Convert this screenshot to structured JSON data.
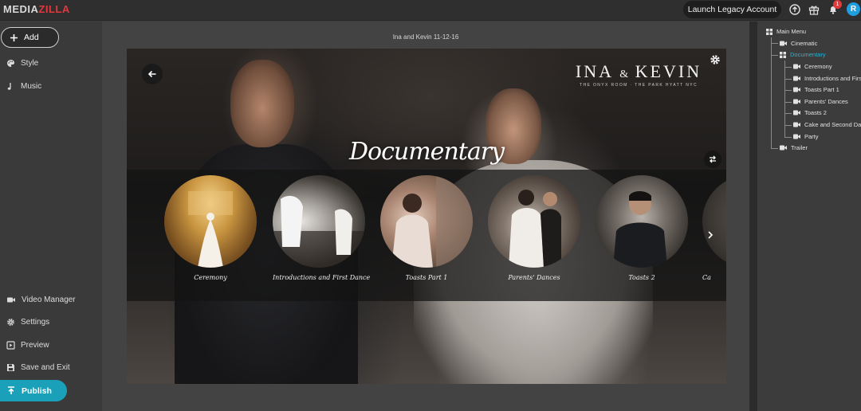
{
  "app": {
    "logo_left": "MEDIA",
    "logo_right": "ZILLA",
    "launch_label": "Launch Legacy Account",
    "notification_count": "1",
    "avatar_initial": "R",
    "accent_color": "#1aa0b8"
  },
  "sidebar": {
    "add_label": "Add",
    "top_items": [
      {
        "label": "Style",
        "icon": "palette-icon"
      },
      {
        "label": "Music",
        "icon": "music-note-icon"
      }
    ],
    "bottom_items": [
      {
        "label": "Video Manager",
        "icon": "video-camera-icon"
      },
      {
        "label": "Settings",
        "icon": "gear-icon"
      },
      {
        "label": "Preview",
        "icon": "play-square-icon"
      },
      {
        "label": "Save and Exit",
        "icon": "floppy-disk-icon"
      }
    ],
    "publish_label": "Publish"
  },
  "preview": {
    "title": "Ina and Kevin 11-12-16",
    "brand_name_left": "INA",
    "brand_amp": "&",
    "brand_name_right": "KEVIN",
    "brand_subtitle": "THE ONYX ROOM · THE PARK HYATT NYC",
    "section_title": "Documentary",
    "thumbnails": [
      {
        "label": "Ceremony"
      },
      {
        "label": "Introductions and First Dance"
      },
      {
        "label": "Toasts Part 1"
      },
      {
        "label": "Parents' Dances"
      },
      {
        "label": "Toasts 2"
      },
      {
        "label": "Ca"
      }
    ]
  },
  "tree": {
    "root": "Main Menu",
    "items": [
      {
        "label": "Cinematic",
        "level": 1,
        "icon": "video-camera-icon",
        "active": false
      },
      {
        "label": "Documentary",
        "level": 1,
        "icon": "grid-icon",
        "active": true
      },
      {
        "label": "Ceremony",
        "level": 2,
        "icon": "video-camera-icon",
        "active": false
      },
      {
        "label": "Introductions and Firs...",
        "level": 2,
        "icon": "video-camera-icon",
        "active": false
      },
      {
        "label": "Toasts Part 1",
        "level": 2,
        "icon": "video-camera-icon",
        "active": false
      },
      {
        "label": "Parents' Dances",
        "level": 2,
        "icon": "video-camera-icon",
        "active": false
      },
      {
        "label": "Toasts 2",
        "level": 2,
        "icon": "video-camera-icon",
        "active": false
      },
      {
        "label": "Cake and Second Da...",
        "level": 2,
        "icon": "video-camera-icon",
        "active": false
      },
      {
        "label": "Party",
        "level": 2,
        "icon": "video-camera-icon",
        "active": false
      },
      {
        "label": "Trailer",
        "level": 1,
        "icon": "video-camera-icon",
        "active": false
      }
    ]
  }
}
